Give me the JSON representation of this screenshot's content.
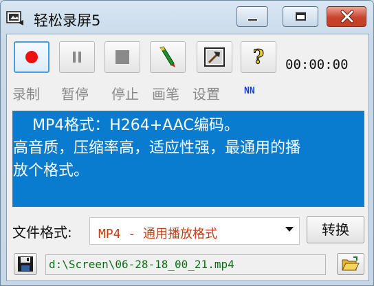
{
  "window": {
    "title": "轻松录屏5",
    "controls": [
      "minimize",
      "maximize",
      "close"
    ]
  },
  "toolbar": {
    "buttons": [
      {
        "icon": "record-icon",
        "label": "录制",
        "active": true
      },
      {
        "icon": "pause-icon",
        "label": "暂停",
        "active": false
      },
      {
        "icon": "stop-icon",
        "label": "停止",
        "active": false
      },
      {
        "icon": "pen-icon",
        "label": "画笔",
        "active": false
      },
      {
        "icon": "settings-tools-icon",
        "label": "设置",
        "active": false
      },
      {
        "icon": "help-icon",
        "label": "",
        "active": false
      }
    ],
    "timer": "00:00:00",
    "extra_label": "NN"
  },
  "info": {
    "lines": [
      "    MP4格式：H264+AAC编码。",
      "高音质，压缩率高，适应性强，最通用的播",
      "放个格式。"
    ],
    "background": "#0a7cd0",
    "text_color": "#ffffff"
  },
  "format": {
    "label": "文件格式:",
    "selected": "MP4 - 通用播放格式",
    "selected_color": "#c93a12",
    "convert_label": "转换"
  },
  "output": {
    "path": "d:\\Screen\\06-28-18_00_21.mp4",
    "path_color": "#0b6f17"
  }
}
